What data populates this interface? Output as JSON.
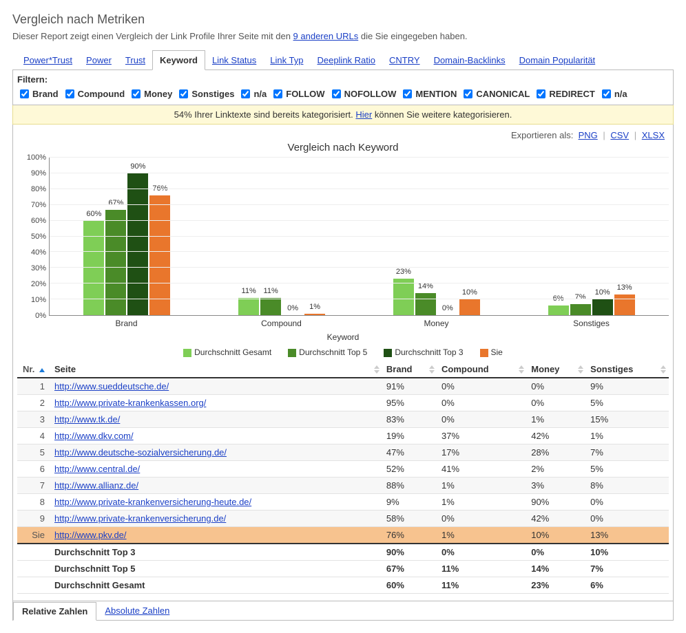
{
  "header": {
    "title": "Vergleich nach Metriken",
    "subtitle_lead": "Dieser Report zeigt einen Vergleich der Link Profile Ihrer Seite mit den ",
    "other_urls_link": "9 anderen URLs",
    "subtitle_tail": " die Sie eingegeben haben."
  },
  "metric_tabs": [
    {
      "label": "Power*Trust",
      "active": false
    },
    {
      "label": "Power",
      "active": false
    },
    {
      "label": "Trust",
      "active": false
    },
    {
      "label": "Keyword",
      "active": true
    },
    {
      "label": "Link Status",
      "active": false
    },
    {
      "label": "Link Typ",
      "active": false
    },
    {
      "label": "Deeplink Ratio",
      "active": false
    },
    {
      "label": "CNTRY",
      "active": false
    },
    {
      "label": "Domain-Backlinks",
      "active": false
    },
    {
      "label": "Domain Popularität",
      "active": false
    }
  ],
  "filter_bar": {
    "label": "Filtern:",
    "filters": [
      {
        "label": "Brand",
        "checked": true
      },
      {
        "label": "Compound",
        "checked": true
      },
      {
        "label": "Money",
        "checked": true
      },
      {
        "label": "Sonstiges",
        "checked": true
      },
      {
        "label": "n/a",
        "checked": true
      },
      {
        "label": "FOLLOW",
        "checked": true
      },
      {
        "label": "NOFOLLOW",
        "checked": true
      },
      {
        "label": "MENTION",
        "checked": true
      },
      {
        "label": "CANONICAL",
        "checked": true
      },
      {
        "label": "REDIRECT",
        "checked": true
      },
      {
        "label": "n/a",
        "checked": true
      }
    ]
  },
  "banner": {
    "lead": "54% Ihrer Linktexte sind bereits kategorisiert. ",
    "link": "Hier",
    "tail": " können Sie weitere kategorisieren."
  },
  "export": {
    "label": "Exportieren als:",
    "png": "PNG",
    "csv": "CSV",
    "xlsx": "XLSX"
  },
  "chart_data": {
    "type": "bar",
    "title": "Vergleich nach Keyword",
    "xlabel": "Keyword",
    "ylabel": "",
    "categories": [
      "Brand",
      "Compound",
      "Money",
      "Sonstiges"
    ],
    "y_ticks": [
      "0%",
      "10%",
      "20%",
      "30%",
      "40%",
      "50%",
      "60%",
      "70%",
      "80%",
      "90%",
      "100%"
    ],
    "ylim": [
      0,
      100
    ],
    "series": [
      {
        "name": "Durchschnitt Gesamt",
        "color": "#7fce56",
        "values": [
          60,
          11,
          23,
          6
        ]
      },
      {
        "name": "Durchschnitt Top 5",
        "color": "#4a8b28",
        "values": [
          67,
          11,
          14,
          7
        ]
      },
      {
        "name": "Durchschnitt Top 3",
        "color": "#1f5014",
        "values": [
          90,
          0,
          0,
          10
        ]
      },
      {
        "name": "Sie",
        "color": "#e9762c",
        "values": [
          76,
          1,
          10,
          13
        ]
      }
    ]
  },
  "table": {
    "headers": {
      "nr": "Nr.",
      "seite": "Seite",
      "brand": "Brand",
      "compound": "Compound",
      "money": "Money",
      "sonstiges": "Sonstiges"
    },
    "rows": [
      {
        "nr": "1",
        "seite": "http://www.sueddeutsche.de/",
        "brand": "91%",
        "compound": "0%",
        "money": "0%",
        "sonstiges": "9%"
      },
      {
        "nr": "2",
        "seite": "http://www.private-krankenkassen.org/",
        "brand": "95%",
        "compound": "0%",
        "money": "0%",
        "sonstiges": "5%"
      },
      {
        "nr": "3",
        "seite": "http://www.tk.de/",
        "brand": "83%",
        "compound": "0%",
        "money": "1%",
        "sonstiges": "15%"
      },
      {
        "nr": "4",
        "seite": "http://www.dkv.com/",
        "brand": "19%",
        "compound": "37%",
        "money": "42%",
        "sonstiges": "1%"
      },
      {
        "nr": "5",
        "seite": "http://www.deutsche-sozialversicherung.de/",
        "brand": "47%",
        "compound": "17%",
        "money": "28%",
        "sonstiges": "7%"
      },
      {
        "nr": "6",
        "seite": "http://www.central.de/",
        "brand": "52%",
        "compound": "41%",
        "money": "2%",
        "sonstiges": "5%"
      },
      {
        "nr": "7",
        "seite": "http://www.allianz.de/",
        "brand": "88%",
        "compound": "1%",
        "money": "3%",
        "sonstiges": "8%"
      },
      {
        "nr": "8",
        "seite": "http://www.private-krankenversicherung-heute.de/",
        "brand": "9%",
        "compound": "1%",
        "money": "90%",
        "sonstiges": "0%"
      },
      {
        "nr": "9",
        "seite": "http://www.private-krankenversicherung.de/",
        "brand": "58%",
        "compound": "0%",
        "money": "42%",
        "sonstiges": "0%"
      },
      {
        "nr": "Sie",
        "seite": "http://www.pkv.de/",
        "brand": "76%",
        "compound": "1%",
        "money": "10%",
        "sonstiges": "13%",
        "highlight": true
      }
    ],
    "footer": [
      {
        "label": "Durchschnitt Top 3",
        "brand": "90%",
        "compound": "0%",
        "money": "0%",
        "sonstiges": "10%"
      },
      {
        "label": "Durchschnitt Top 5",
        "brand": "67%",
        "compound": "11%",
        "money": "14%",
        "sonstiges": "7%"
      },
      {
        "label": "Durchschnitt Gesamt",
        "brand": "60%",
        "compound": "11%",
        "money": "23%",
        "sonstiges": "6%"
      }
    ]
  },
  "bottom_tabs": [
    {
      "label": "Relative Zahlen",
      "active": true
    },
    {
      "label": "Absolute Zahlen",
      "active": false
    }
  ]
}
